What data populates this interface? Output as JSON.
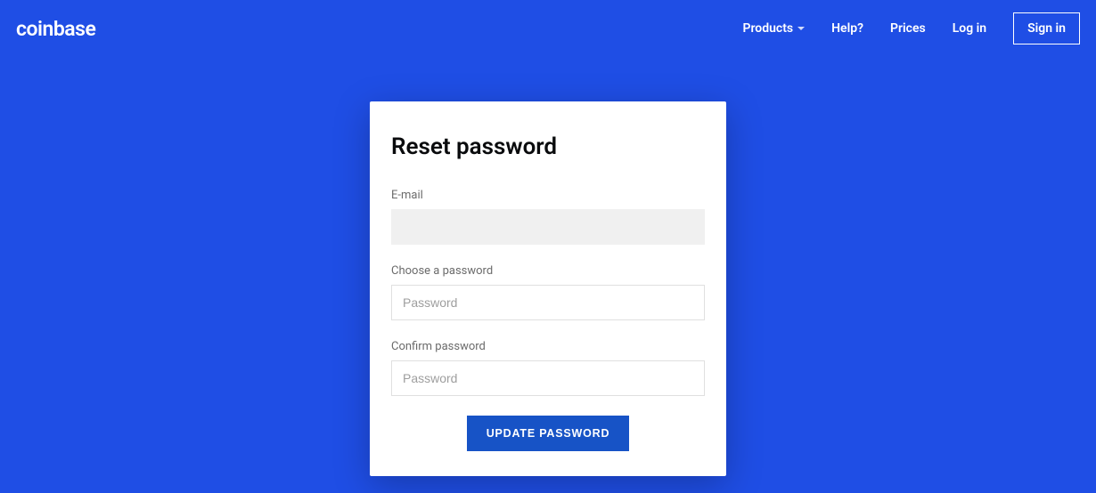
{
  "header": {
    "logo": "coinbase",
    "nav": {
      "products": "Products",
      "help": "Help?",
      "prices": "Prices",
      "login": "Log in",
      "signin": "Sign in"
    }
  },
  "card": {
    "title": "Reset password",
    "email_label": "E-mail",
    "email_value": "",
    "choose_label": "Choose a password",
    "choose_placeholder": "Password",
    "confirm_label": "Confirm password",
    "confirm_placeholder": "Password",
    "submit_label": "UPDATE PASSWORD"
  }
}
